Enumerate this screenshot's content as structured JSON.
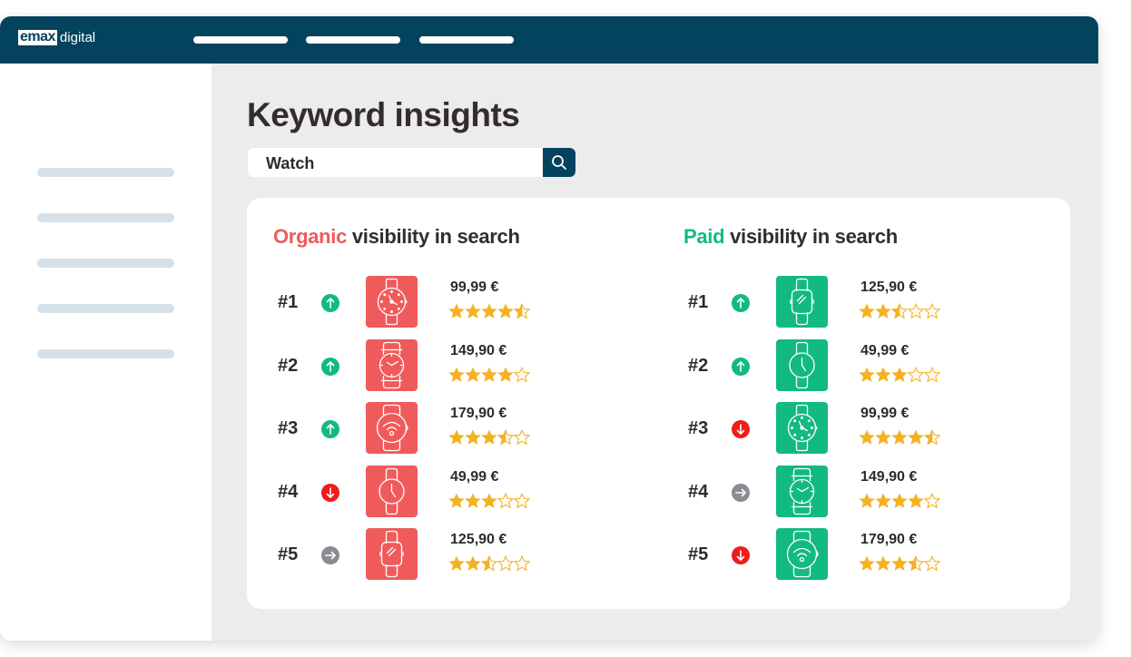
{
  "app": {
    "logo_box": "emax",
    "logo_text": "digital",
    "nav_item_count": 3
  },
  "colors": {
    "header_bg": "#03435e",
    "organic": "#ef5b5b",
    "paid": "#13b983",
    "trend_up": "#13b983",
    "trend_down": "#ee1c1c",
    "trend_flat": "#8a8c94",
    "star_fill": "#f4b223"
  },
  "page": {
    "title": "Keyword insights"
  },
  "search": {
    "value": "Watch",
    "placeholder": "",
    "button_icon": "search-icon"
  },
  "organic": {
    "title_accent": "Organic",
    "title_rest": " visibility in search",
    "items": [
      {
        "rank": "#1",
        "trend": "up",
        "icon": "analog-watch-dotted",
        "price": "99,99 €",
        "rating": 4.5
      },
      {
        "rank": "#2",
        "trend": "up",
        "icon": "analog-watch-wide",
        "price": "149,90 €",
        "rating": 4
      },
      {
        "rank": "#3",
        "trend": "up",
        "icon": "smartwatch-wifi",
        "price": "179,90 €",
        "rating": 3.5
      },
      {
        "rank": "#4",
        "trend": "down",
        "icon": "analog-watch-simple",
        "price": " 49,99 €",
        "rating": 3
      },
      {
        "rank": "#5",
        "trend": "flat",
        "icon": "smartwatch-square",
        "price": "125,90 €",
        "rating": 2.5
      }
    ]
  },
  "paid": {
    "title_accent": "Paid",
    "title_rest": " visibility in search",
    "items": [
      {
        "rank": "#1",
        "trend": "up",
        "icon": "smartwatch-square",
        "price": "125,90 €",
        "rating": 2.5
      },
      {
        "rank": "#2",
        "trend": "up",
        "icon": "analog-watch-simple",
        "price": "49,99 €",
        "rating": 3
      },
      {
        "rank": "#3",
        "trend": "down",
        "icon": "analog-watch-dotted",
        "price": "99,99 €",
        "rating": 4.5
      },
      {
        "rank": "#4",
        "trend": "flat",
        "icon": "analog-watch-wide",
        "price": "149,90 €",
        "rating": 4
      },
      {
        "rank": "#5",
        "trend": "down",
        "icon": "smartwatch-wifi",
        "price": "179,90 €",
        "rating": 3.5
      }
    ]
  }
}
